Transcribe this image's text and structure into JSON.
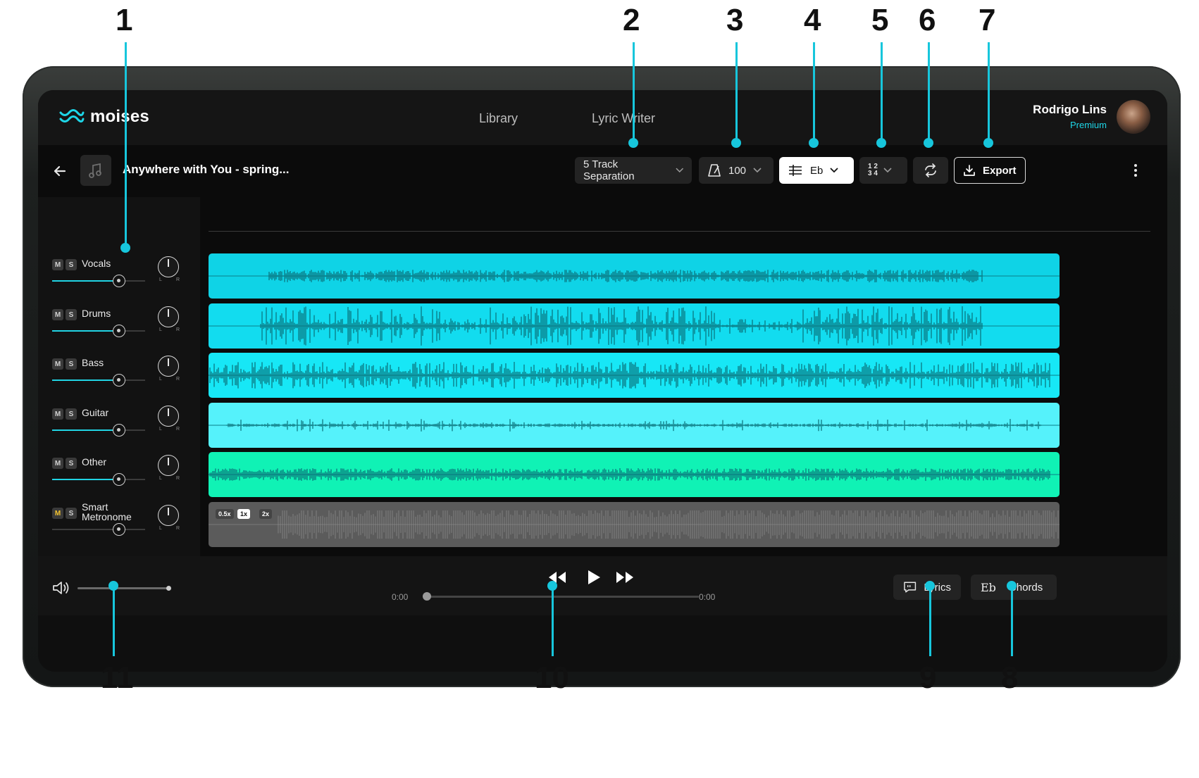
{
  "app": {
    "logo_text": "moises"
  },
  "nav": {
    "library": "Library",
    "lyric_writer": "Lyric Writer"
  },
  "user": {
    "name": "Rodrigo Lins",
    "plan": "Premium"
  },
  "song": {
    "title": "Anywhere with You - spring..."
  },
  "toolbar": {
    "separation": "5 Track Separation",
    "tempo": "100",
    "key": "Eb",
    "time_signature_top": "1 2",
    "time_signature_bottom": "3 4",
    "export": "Export"
  },
  "tracks": [
    {
      "name": "Vocals",
      "volume": 0.72,
      "color": "#0fd3e6"
    },
    {
      "name": "Drums",
      "volume": 0.72,
      "color": "#12dcef"
    },
    {
      "name": "Bass",
      "volume": 0.72,
      "color": "#17e7f6"
    },
    {
      "name": "Guitar",
      "volume": 0.72,
      "color": "#55f2fb"
    },
    {
      "name": "Other",
      "volume": 0.72,
      "color": "#10f2b5"
    },
    {
      "name": "Smart Metronome",
      "name_line1": "Smart",
      "name_line2": "Metronome",
      "volume": 0.72,
      "color": "#5b5b5b"
    }
  ],
  "mixer": {
    "mute": "M",
    "solo": "S",
    "pan_left": "L",
    "pan_right": "R"
  },
  "metronome_speeds": [
    "0.5x",
    "1x",
    "2x"
  ],
  "metronome_active_speed": "1x",
  "player": {
    "time_current": "0:00",
    "time_total": "0:00",
    "lyrics": "Lyrics",
    "chords": "Chords",
    "chords_icon": "Eb"
  },
  "callouts": [
    "1",
    "2",
    "3",
    "4",
    "5",
    "6",
    "7",
    "8",
    "9",
    "10",
    "11"
  ],
  "icons": [
    "back-arrow-icon",
    "music-note-icon",
    "chevron-down-icon",
    "metronome-icon",
    "key-sliders-icon",
    "loop-icon",
    "download-icon",
    "more-vertical-icon",
    "speaker-icon",
    "rewind-icon",
    "play-icon",
    "fast-forward-icon",
    "lyrics-icon"
  ]
}
